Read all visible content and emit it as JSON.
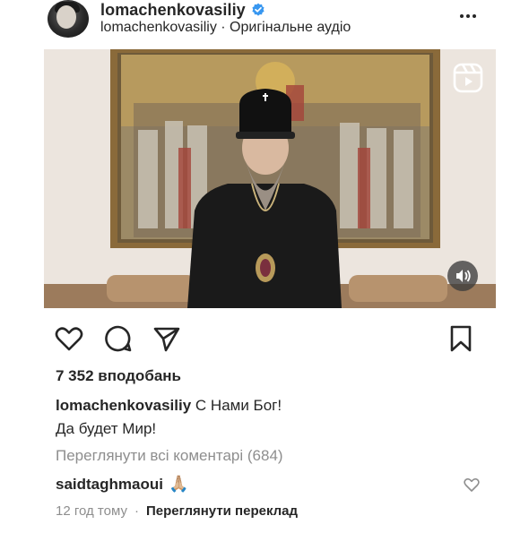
{
  "post": {
    "username": "lomachenkovasiliy",
    "subline": "lomachenkovasiliy · Оригінальне аудіо",
    "likes": "7 352 вподобань",
    "caption_user": "lomachenkovasiliy",
    "caption_text1": "С Нами Бог!",
    "caption_text2": "Да будет Мир!",
    "view_comments": "Переглянути всі коментарі (684)",
    "comment_user": "saidtaghmaoui",
    "comment_emoji": "🙏🏼",
    "time_ago": "12 год тому",
    "translate": "Переглянути переклад"
  },
  "icons": {
    "verified": "verified-badge-icon",
    "more": "more-options-icon",
    "reel": "reels-icon",
    "sound": "sound-icon",
    "like": "heart-icon",
    "comment": "comment-icon",
    "share": "send-icon",
    "save": "bookmark-icon"
  },
  "colors": {
    "text": "#262626",
    "muted": "#8e8e8e",
    "verified": "#3897f0"
  }
}
